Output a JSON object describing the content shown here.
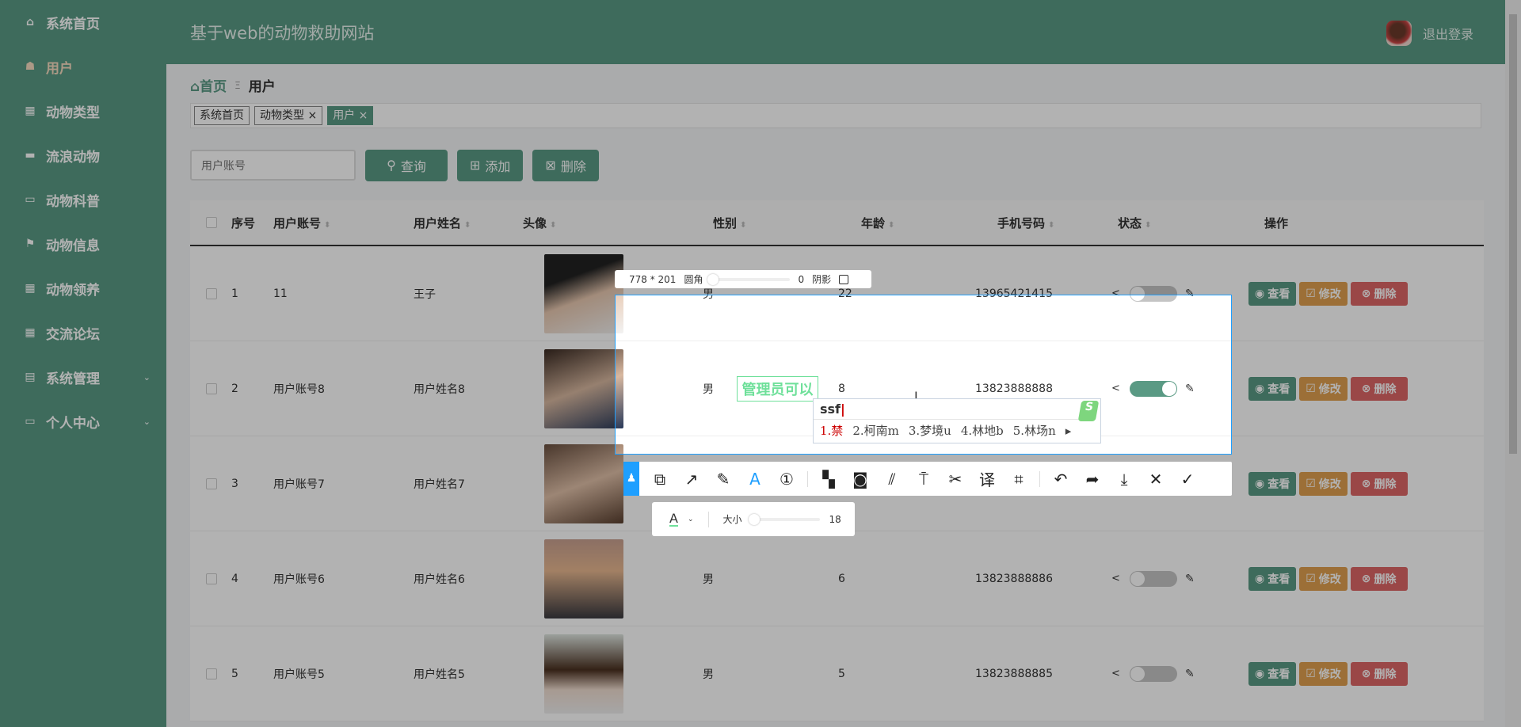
{
  "app_title": "基于web的动物救助网站",
  "logout_label": "退出登录",
  "sidebar": {
    "items": [
      {
        "label": "系统首页",
        "icon": "home-icon"
      },
      {
        "label": "用户",
        "icon": "user-icon"
      },
      {
        "label": "动物类型",
        "icon": "grid-icon"
      },
      {
        "label": "流浪动物",
        "icon": "chat-icon"
      },
      {
        "label": "动物科普",
        "icon": "monitor-icon"
      },
      {
        "label": "动物信息",
        "icon": "flag-icon"
      },
      {
        "label": "动物领养",
        "icon": "grid-icon"
      },
      {
        "label": "交流论坛",
        "icon": "grid-icon"
      },
      {
        "label": "系统管理",
        "icon": "doc-icon"
      },
      {
        "label": "个人中心",
        "icon": "card-icon"
      }
    ]
  },
  "breadcrumb": {
    "home": "首页",
    "sep": "Ξ",
    "current": "用户"
  },
  "tabs": [
    "系统首页",
    "动物类型 ×",
    "用户 ×"
  ],
  "search": {
    "placeholder": "用户账号",
    "query_label": "查询",
    "add_label": "添加",
    "delete_label": "删除"
  },
  "table": {
    "headers": [
      "序号",
      "用户账号",
      "用户姓名",
      "头像",
      "性别",
      "年龄",
      "手机号码",
      "状态",
      "操作"
    ],
    "actions": {
      "view": "查看",
      "edit": "修改",
      "delete": "删除"
    },
    "rows": [
      {
        "no": "1",
        "account": "11",
        "name": "王子",
        "gender": "男",
        "age": "22",
        "phone": "13965421415",
        "status_on": false
      },
      {
        "no": "2",
        "account": "用户账号8",
        "name": "用户姓名8",
        "gender": "男",
        "age": "8",
        "phone": "13823888888",
        "status_on": true
      },
      {
        "no": "3",
        "account": "用户账号7",
        "name": "用户姓名7",
        "gender": "",
        "age": "",
        "phone": "",
        "status_on": false
      },
      {
        "no": "4",
        "account": "用户账号6",
        "name": "用户姓名6",
        "gender": "男",
        "age": "6",
        "phone": "13823888886",
        "status_on": false
      },
      {
        "no": "5",
        "account": "用户账号5",
        "name": "用户姓名5",
        "gender": "男",
        "age": "5",
        "phone": "13823888885",
        "status_on": false
      }
    ]
  },
  "capture": {
    "dimensions": "778 * 201",
    "radius_label": "圆角",
    "radius_value": "0",
    "shadow_label": "阴影",
    "annotation_text": "管理员可以",
    "size_label": "大小",
    "size_value": "18",
    "font_color": "#6fe09a"
  },
  "ime": {
    "composition": "ssf",
    "candidates": [
      "1.禁",
      "2.柯南m",
      "3.梦境u",
      "4.林地b",
      "5.林场n"
    ]
  }
}
